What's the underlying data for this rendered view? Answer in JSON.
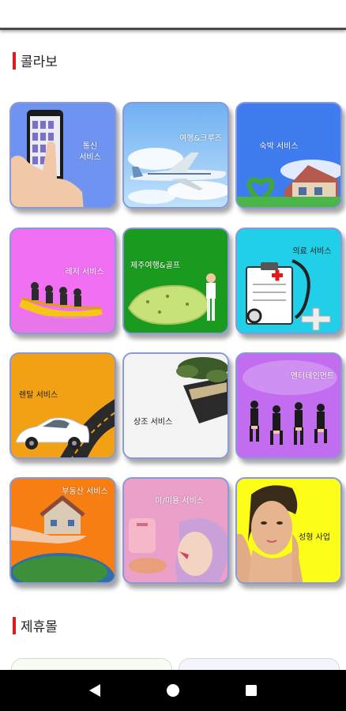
{
  "sections": {
    "collab_title": "콜라보",
    "partner_title": "제휴몰"
  },
  "tiles": [
    {
      "label": "통신\n서비스",
      "icon": "phone-hand-image"
    },
    {
      "label": "여행&크루즈",
      "icon": "airplane-image"
    },
    {
      "label": "숙박 서비스",
      "icon": "pension-image"
    },
    {
      "label": "레저 서비스",
      "icon": "rafting-image"
    },
    {
      "label": "제주여행&골프",
      "icon": "jeju-golf-image"
    },
    {
      "label": "의료 서비스",
      "icon": "medical-clipboard-image"
    },
    {
      "label": "렌탈 서비스",
      "icon": "car-road-image"
    },
    {
      "label": "상조 서비스",
      "icon": "funeral-image"
    },
    {
      "label": "엔터테인먼트",
      "icon": "dancers-image"
    },
    {
      "label": "부동산 서비스",
      "icon": "house-globe-image"
    },
    {
      "label": "미/미용 서비스",
      "icon": "beauty-makeup-image"
    },
    {
      "label": "성형 사업",
      "icon": "face-model-image"
    }
  ],
  "colors": {
    "accent_bar": "#e11a1a",
    "tile_border": "#8a9ad8"
  },
  "navbar": {
    "back": "back-triangle-icon",
    "home": "home-circle-icon",
    "recents": "recents-square-icon"
  }
}
